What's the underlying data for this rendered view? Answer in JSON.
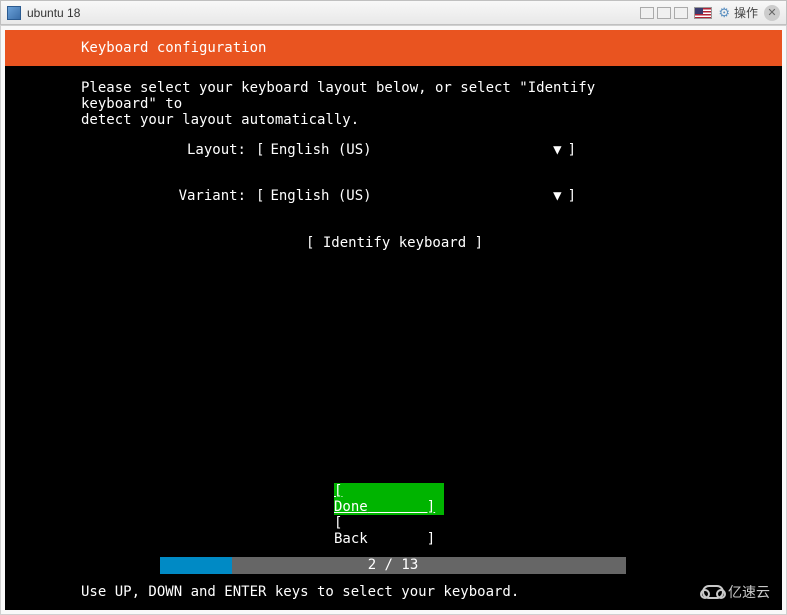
{
  "vm": {
    "title": "ubuntu 18",
    "action_label": "操作"
  },
  "header": {
    "title": "Keyboard configuration"
  },
  "instruction": "Please select your keyboard layout below, or select \"Identify keyboard\" to\ndetect your layout automatically.",
  "form": {
    "layout_label": "Layout:",
    "layout_value": "English (US)",
    "variant_label": "Variant:",
    "variant_value": "English (US)",
    "identify_label": "Identify keyboard"
  },
  "buttons": {
    "done": "Done",
    "back": "Back"
  },
  "progress": {
    "current": 2,
    "total": 13,
    "text": "2 / 13",
    "percent": 15.4
  },
  "hint": "Use UP, DOWN and ENTER keys to select your keyboard.",
  "watermark": "亿速云"
}
